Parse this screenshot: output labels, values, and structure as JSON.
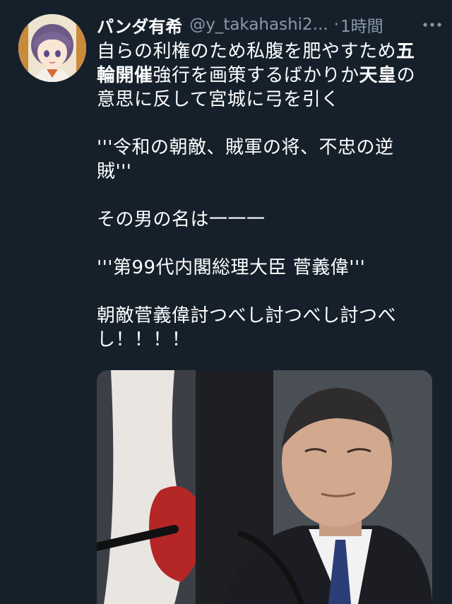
{
  "tweet": {
    "display_name": "パンダ有希",
    "handle": "@y_takahashi2...",
    "separator": "·",
    "time": "1時間",
    "lines": {
      "l1": "自らの利権のため私腹を肥やすため",
      "l1_bold": "五",
      "l2_bold1": "輪開催",
      "l2_mid": "強行を画策するばかりか",
      "l2_bold2": "天皇",
      "l2_end": "の",
      "l3": "意思に反して宮城に弓を引く",
      "l4": "'''令和の朝敵、賊軍の将、不忠の逆",
      "l5": "賊'''",
      "l6": "その男の名は一一一",
      "l7": "'''第99代内閣総理大臣 菅義偉'''",
      "l8": "朝敵菅義偉討つべし討つべし討つべ",
      "l9": "し！！！！"
    }
  },
  "icons": {
    "avatar": "anime-avatar-icon",
    "more": "more-options-icon"
  },
  "colors": {
    "background": "#15202b",
    "text": "#ffffff",
    "secondary": "#8899a6"
  }
}
